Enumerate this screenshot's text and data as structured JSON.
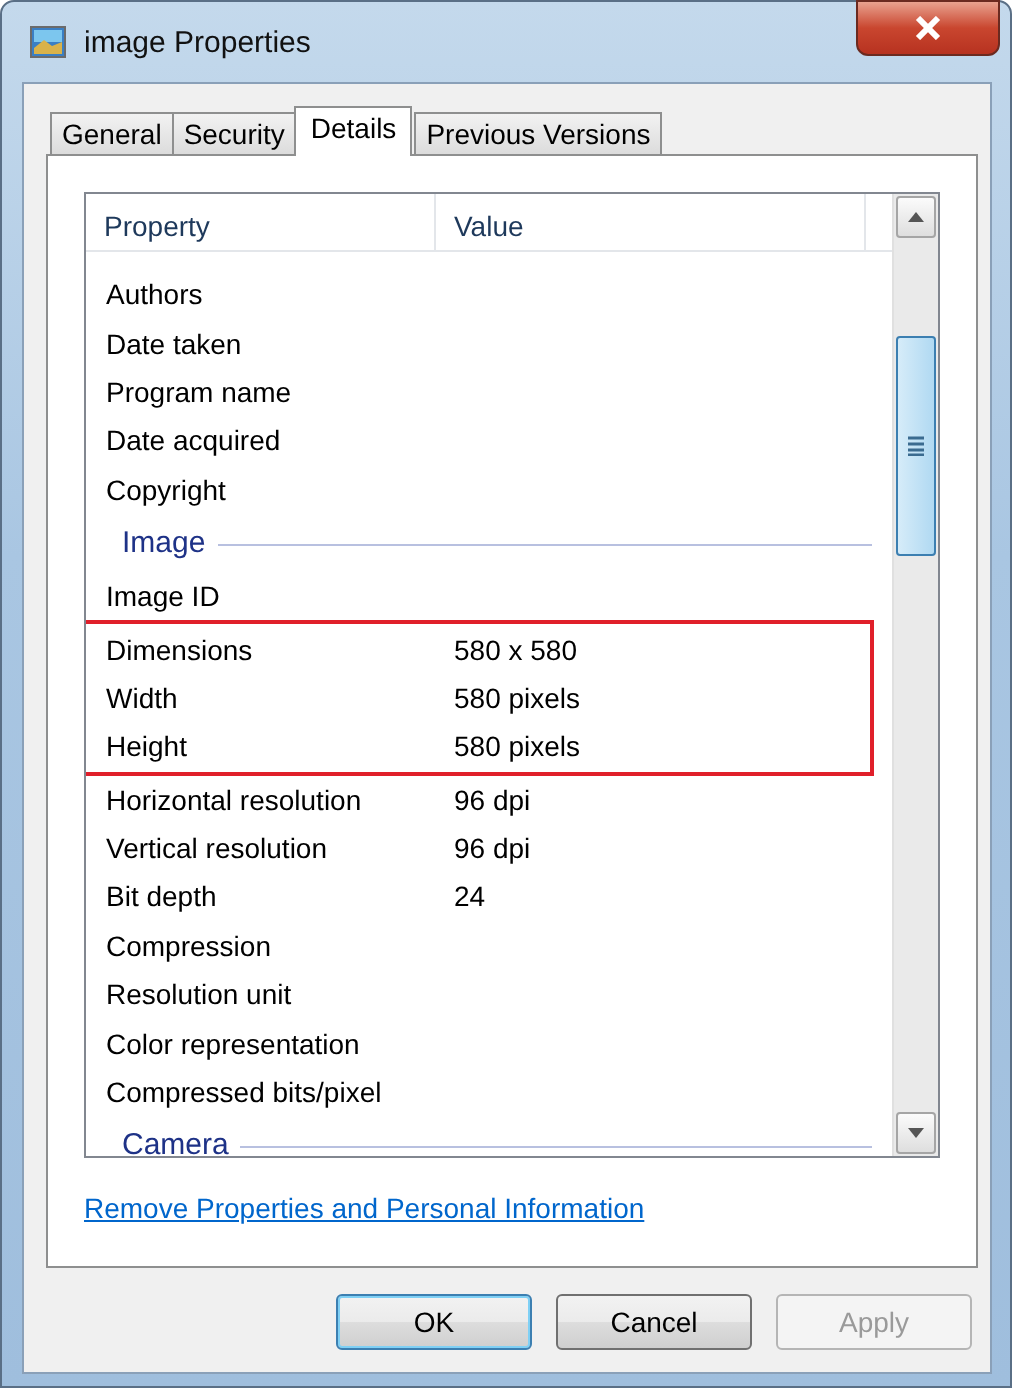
{
  "window": {
    "title": "image Properties"
  },
  "tabs": [
    {
      "label": "General",
      "selected": false
    },
    {
      "label": "Security",
      "selected": false
    },
    {
      "label": "Details",
      "selected": true
    },
    {
      "label": "Previous Versions",
      "selected": false
    }
  ],
  "table": {
    "columns": [
      "Property",
      "Value"
    ],
    "rows": [
      {
        "kind": "property",
        "name": "Authors",
        "value": "",
        "highlighted": false
      },
      {
        "kind": "property",
        "name": "Date taken",
        "value": "",
        "highlighted": false
      },
      {
        "kind": "property",
        "name": "Program name",
        "value": "",
        "highlighted": false
      },
      {
        "kind": "property",
        "name": "Date acquired",
        "value": "",
        "highlighted": false
      },
      {
        "kind": "property",
        "name": "Copyright",
        "value": "",
        "highlighted": false
      },
      {
        "kind": "group",
        "name": "Image"
      },
      {
        "kind": "property",
        "name": "Image ID",
        "value": "",
        "highlighted": false
      },
      {
        "kind": "property",
        "name": "Dimensions",
        "value": "580 x 580",
        "highlighted": true
      },
      {
        "kind": "property",
        "name": "Width",
        "value": "580 pixels",
        "highlighted": true
      },
      {
        "kind": "property",
        "name": "Height",
        "value": "580 pixels",
        "highlighted": true
      },
      {
        "kind": "property",
        "name": "Horizontal resolution",
        "value": "96 dpi",
        "highlighted": false
      },
      {
        "kind": "property",
        "name": "Vertical resolution",
        "value": "96 dpi",
        "highlighted": false
      },
      {
        "kind": "property",
        "name": "Bit depth",
        "value": "24",
        "highlighted": false
      },
      {
        "kind": "property",
        "name": "Compression",
        "value": "",
        "highlighted": false
      },
      {
        "kind": "property",
        "name": "Resolution unit",
        "value": "",
        "highlighted": false
      },
      {
        "kind": "property",
        "name": "Color representation",
        "value": "",
        "highlighted": false
      },
      {
        "kind": "property",
        "name": "Compressed bits/pixel",
        "value": "",
        "highlighted": false
      },
      {
        "kind": "group",
        "name": "Camera"
      }
    ]
  },
  "link": "Remove Properties and Personal Information",
  "buttons": [
    {
      "label": "OK",
      "default": true,
      "disabled": false
    },
    {
      "label": "Cancel",
      "default": false,
      "disabled": false
    },
    {
      "label": "Apply",
      "default": false,
      "disabled": true
    }
  ]
}
